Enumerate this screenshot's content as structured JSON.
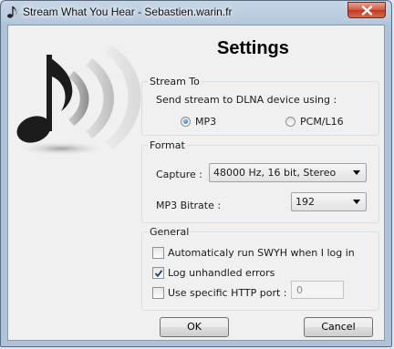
{
  "window": {
    "title": "Stream What You Hear - Sebastien.warin.fr",
    "icons": {
      "app": "music-note-icon",
      "close": "close-icon"
    }
  },
  "heading": "Settings",
  "stream_to": {
    "legend": "Stream To",
    "description": "Send stream to DLNA device using :",
    "options": [
      {
        "label": "MP3",
        "selected": true
      },
      {
        "label": "PCM/L16",
        "selected": false
      }
    ]
  },
  "format": {
    "legend": "Format",
    "capture_label": "Capture :",
    "capture_value": "48000 Hz, 16 bit, Stereo",
    "bitrate_label": "MP3 Bitrate :",
    "bitrate_value": "192"
  },
  "general": {
    "legend": "General",
    "auto_run_label": "Automaticaly run SWYH when I log in",
    "auto_run_checked": false,
    "log_errors_label": "Log unhandled errors",
    "log_errors_checked": true,
    "http_port_label": "Use specific HTTP port :",
    "http_port_checked": false,
    "http_port_value": "0"
  },
  "buttons": {
    "ok": "OK",
    "cancel": "Cancel"
  },
  "colors": {
    "accent": "#2b72c2",
    "close": "#c7432a"
  }
}
